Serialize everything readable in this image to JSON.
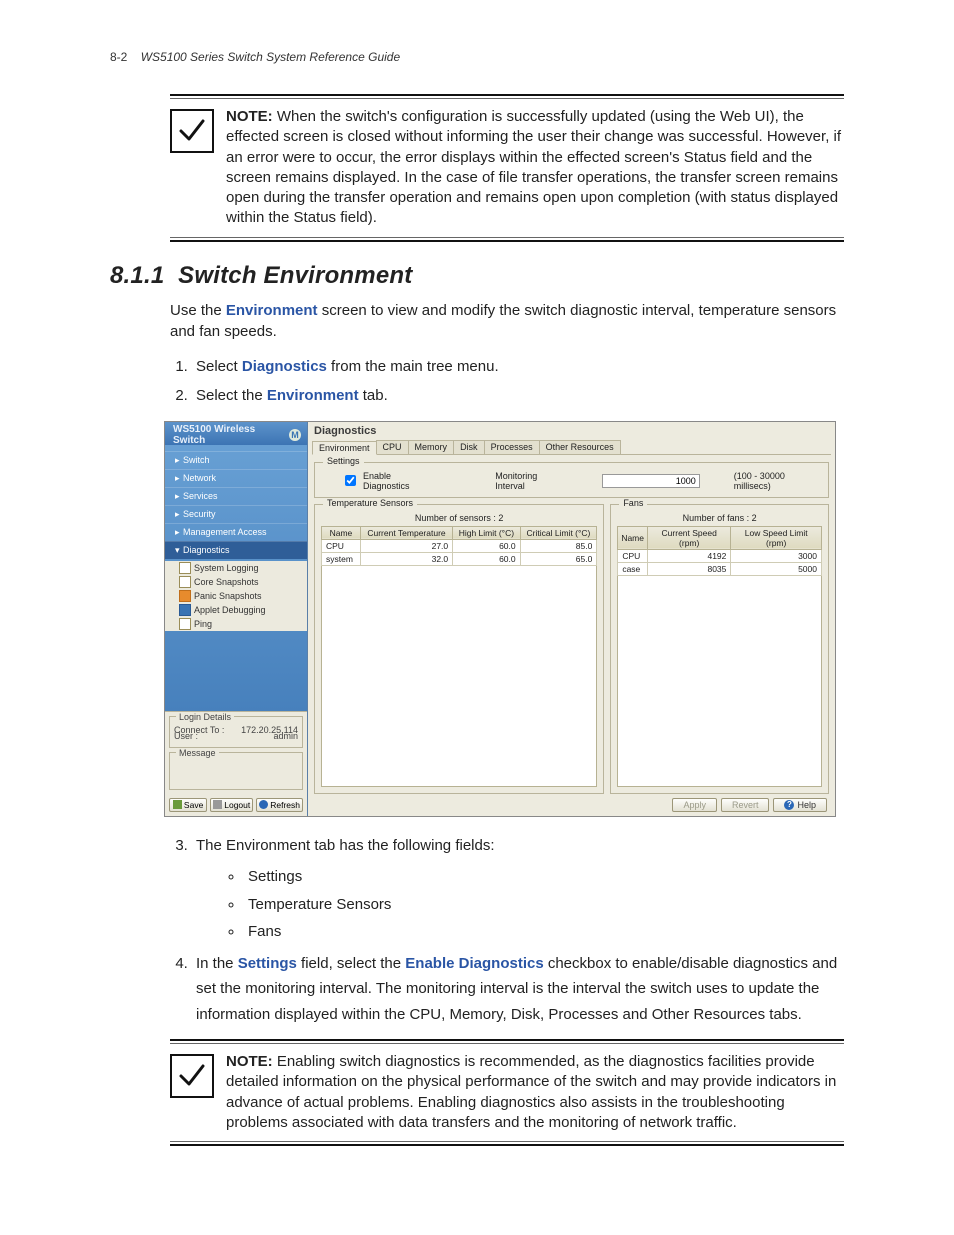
{
  "page": {
    "number": "8-2",
    "running_title": "WS5100 Series Switch System Reference Guide"
  },
  "note1": {
    "label": "NOTE:",
    "text": " When the switch's configuration is successfully updated (using the Web UI), the effected screen is closed without informing the user their change was successful. However, if an error were to occur, the error displays within the effected screen's Status field and the screen remains displayed. In the case of file transfer operations, the transfer screen remains open during the transfer operation and remains open upon completion (with status displayed within the Status field)."
  },
  "section": {
    "number": "8.1.1",
    "title": "Switch Environment"
  },
  "intro": {
    "pre": "Use the ",
    "env": "Environment",
    "post": " screen to view and modify the switch diagnostic interval, temperature sensors and fan speeds."
  },
  "step1": {
    "pre": "Select ",
    "bold": "Diagnostics",
    "post": " from the main tree menu."
  },
  "step2": {
    "pre": "Select the ",
    "bold": "Environment",
    "post": " tab."
  },
  "step3": {
    "text": "The Environment tab has the following fields:"
  },
  "bullets": {
    "b1": "Settings",
    "b2": "Temperature Sensors",
    "b3": "Fans"
  },
  "step4": {
    "pre": "In the ",
    "b1": "Settings",
    "mid": " field, select the ",
    "b2": "Enable Diagnostics",
    "post": " checkbox to enable/disable diagnostics and set the monitoring interval. The monitoring interval is the interval the switch uses to update the information displayed within the CPU, Memory, Disk, Processes and Other Resources tabs."
  },
  "note2": {
    "label": "NOTE:",
    "text": " Enabling switch diagnostics is recommended, as the diagnostics facilities provide detailed information on the physical performance of the switch and may provide indicators in advance of actual problems. Enabling diagnostics also assists in the troubleshooting problems associated with data transfers and the monitoring of network traffic."
  },
  "ui": {
    "brand": "WS5100 Wireless Switch",
    "brand_logo": "M",
    "tree": {
      "switch": "Switch",
      "network": "Network",
      "services": "Services",
      "security": "Security",
      "mgmt": "Management Access",
      "diag": "Diagnostics",
      "sub": {
        "syslog": "System Logging",
        "core": "Core Snapshots",
        "panic": "Panic Snapshots",
        "applet": "Applet Debugging",
        "ping": "Ping"
      }
    },
    "login": {
      "legend": "Login Details",
      "connect_lbl": "Connect To :",
      "connect_val": "172.20.25.114",
      "user_lbl": "User :",
      "user_val": "admin"
    },
    "message_legend": "Message",
    "btn_save": "Save",
    "btn_logout": "Logout",
    "btn_refresh": "Refresh",
    "main_title": "Diagnostics",
    "tabs": {
      "env": "Environment",
      "cpu": "CPU",
      "mem": "Memory",
      "disk": "Disk",
      "proc": "Processes",
      "other": "Other Resources"
    },
    "settings": {
      "legend": "Settings",
      "enable": "Enable Diagnostics",
      "mon_lbl": "Monitoring Interval",
      "mon_val": "1000",
      "mon_hint": "(100 - 30000 millisecs)"
    },
    "temp": {
      "legend": "Temperature Sensors",
      "count": "Number of sensors : 2",
      "h_name": "Name",
      "h_curr": "Current Temperature",
      "h_high": "High Limit (°C)",
      "h_crit": "Critical Limit (°C)",
      "r1": {
        "name": "CPU",
        "curr": "27.0",
        "high": "60.0",
        "crit": "85.0"
      },
      "r2": {
        "name": "system",
        "curr": "32.0",
        "high": "60.0",
        "crit": "65.0"
      }
    },
    "fans": {
      "legend": "Fans",
      "count": "Number of fans : 2",
      "h_name": "Name",
      "h_curr": "Current Speed (rpm)",
      "h_low": "Low Speed Limit (rpm)",
      "r1": {
        "name": "CPU",
        "curr": "4192",
        "low": "3000"
      },
      "r2": {
        "name": "case",
        "curr": "8035",
        "low": "5000"
      }
    },
    "footer": {
      "apply": "Apply",
      "revert": "Revert",
      "help": "Help"
    }
  }
}
